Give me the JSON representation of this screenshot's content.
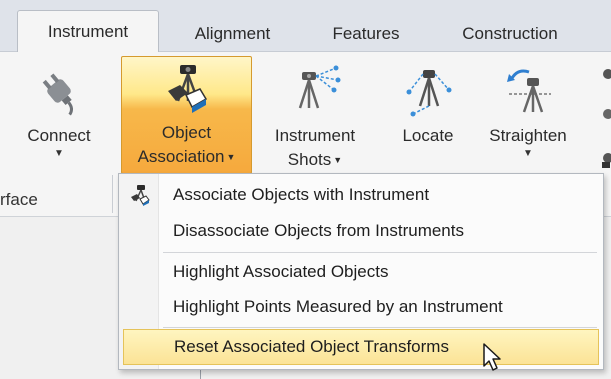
{
  "tabs": [
    {
      "label": "Instrument",
      "active": true
    },
    {
      "label": "Alignment",
      "active": false
    },
    {
      "label": "Features",
      "active": false
    },
    {
      "label": "Construction",
      "active": false
    }
  ],
  "ribbon": {
    "group_label": "rface",
    "buttons": [
      {
        "name": "connect",
        "label": "Connect",
        "icon": "plug-icon",
        "has_dropdown": true
      },
      {
        "name": "object-association",
        "label_line1": "Object",
        "label_line2": "Association",
        "icon": "tripod-objects-icon",
        "has_dropdown": true,
        "selected": true
      },
      {
        "name": "instrument-shots",
        "label_line1": "Instrument",
        "label_line2": "Shots",
        "icon": "tripod-shots-icon",
        "has_dropdown": true
      },
      {
        "name": "locate",
        "label": "Locate",
        "icon": "tripod-locate-icon",
        "has_dropdown": false
      },
      {
        "name": "straighten",
        "label": "Straighten",
        "icon": "tripod-straighten-icon",
        "has_dropdown": true
      }
    ]
  },
  "menu": {
    "items": [
      {
        "label": "Associate Objects with Instrument",
        "icon": "associate-icon"
      },
      {
        "label": "Disassociate Objects from Instruments",
        "icon": ""
      },
      {
        "label": "Highlight Associated Objects",
        "icon": ""
      },
      {
        "label": "Highlight Points Measured by an Instrument",
        "icon": ""
      },
      {
        "label": "Reset Associated Object Transforms",
        "icon": "",
        "highlighted": true
      }
    ]
  },
  "colors": {
    "accent_orange": "#f6a93d",
    "hover_yellow": "#fbe396",
    "tab_bar": "#dfe3ea"
  }
}
